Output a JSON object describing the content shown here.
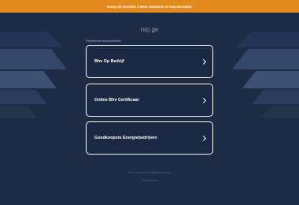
{
  "promo": {
    "text": "Koop dit domein. | Meer domeins at Sea.Domains"
  },
  "domain": {
    "name": "nrp.ge"
  },
  "related": {
    "heading": "Gerelateerde zoekopdrachten",
    "links": [
      {
        "label": "Bhv Op Bedrijf"
      },
      {
        "label": "Online Bhv Certificaat"
      },
      {
        "label": "Goedkoopste Energiebedrijven"
      }
    ]
  },
  "footer": {
    "copyright": "2024 Copyright | All Rights Reserved.",
    "privacy": "Privacy Policy"
  },
  "colors": {
    "background": "#1d2b45",
    "promo_bar": "#e28a1e",
    "card_border": "#ffffff"
  }
}
